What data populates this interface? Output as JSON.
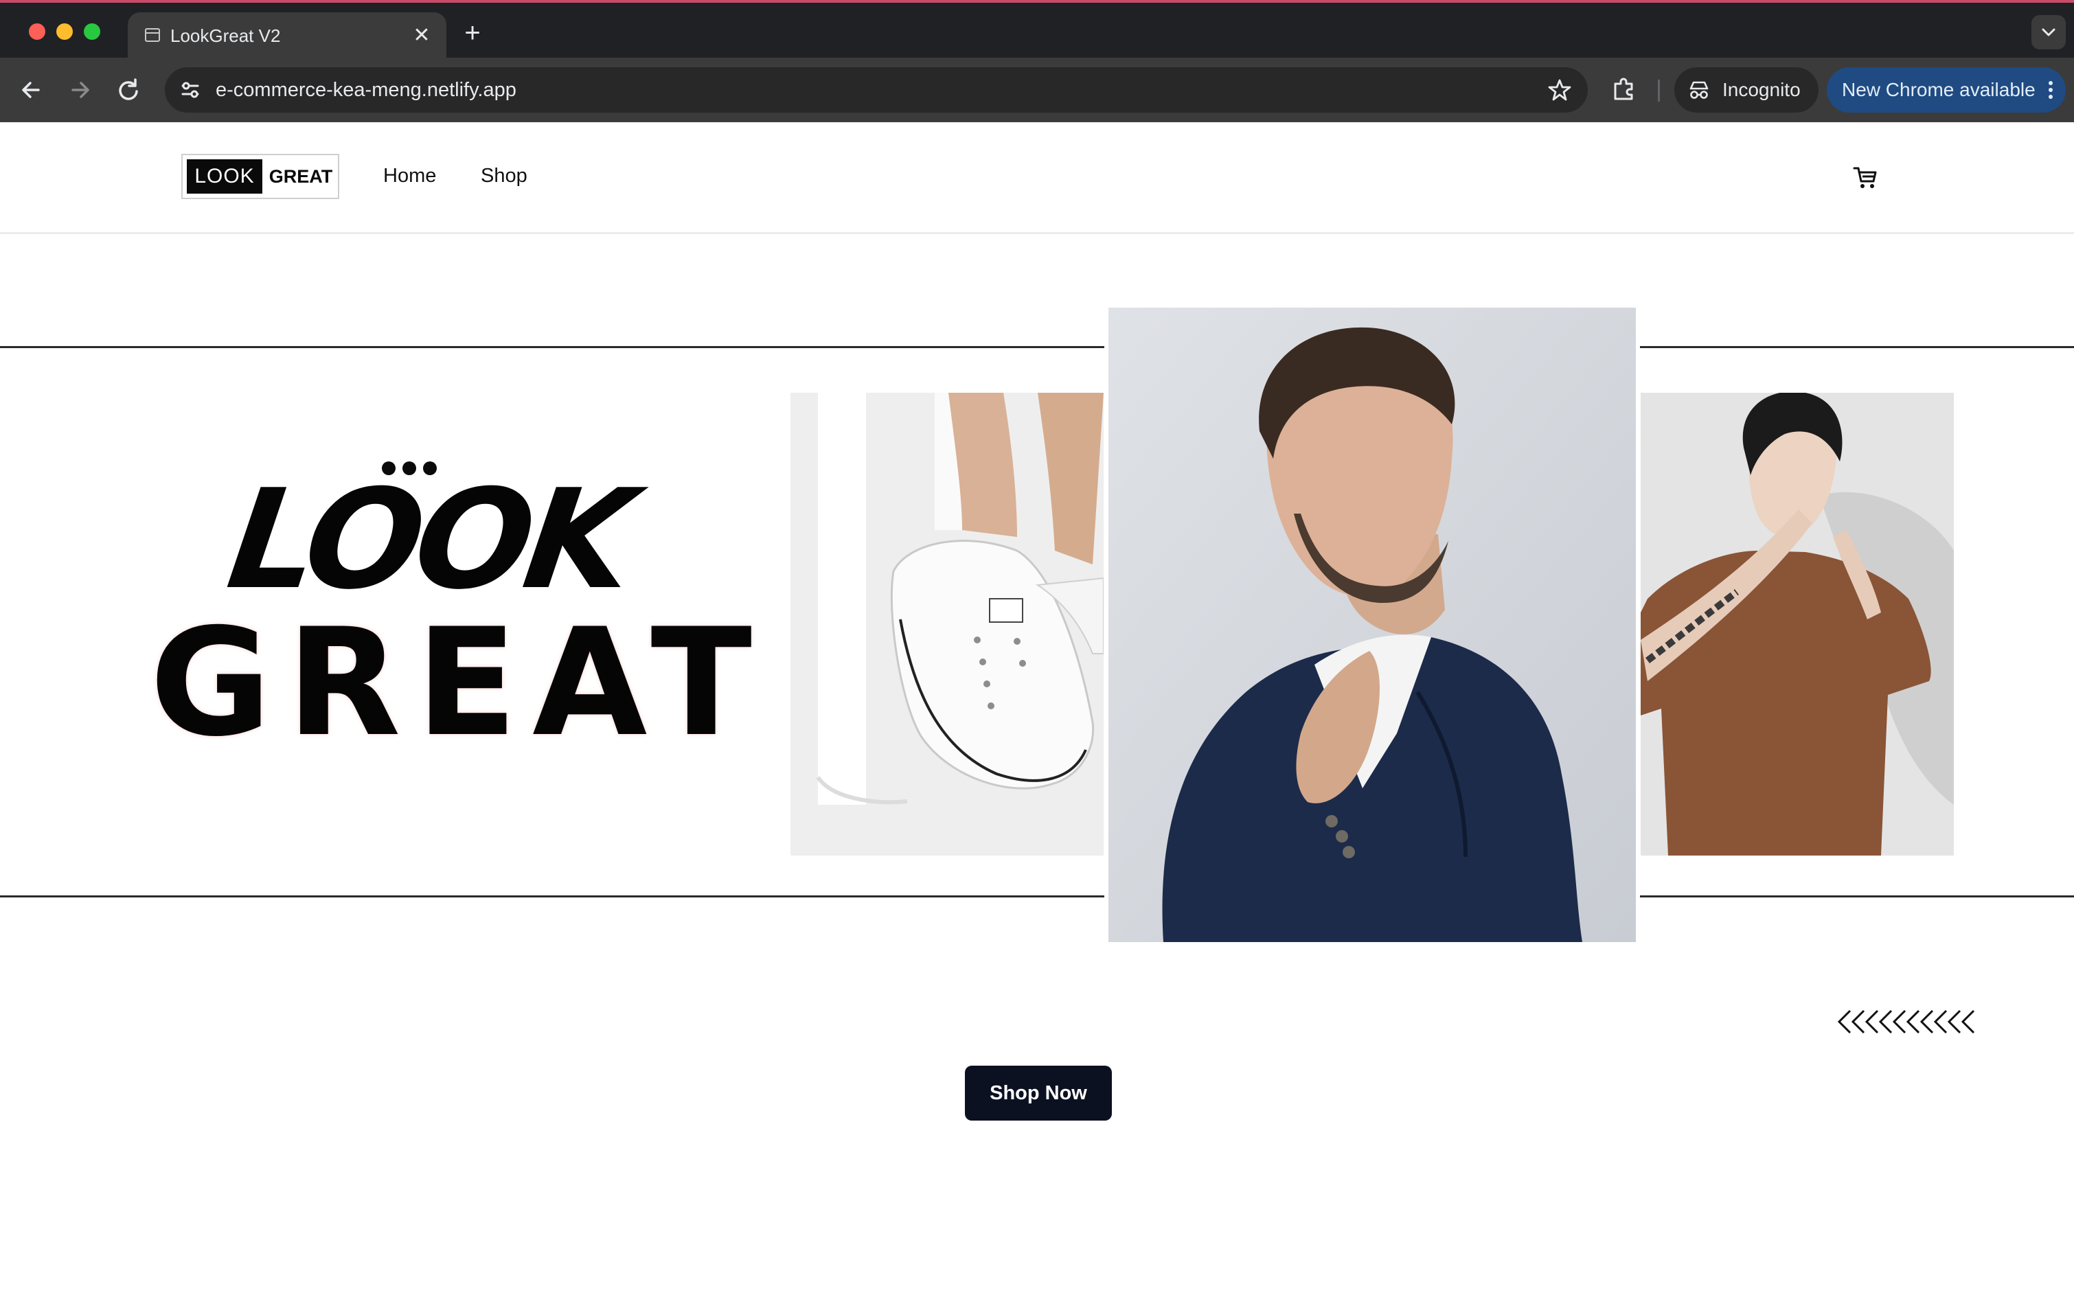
{
  "browser": {
    "tab_title": "LookGreat V2",
    "url": "e-commerce-kea-meng.netlify.app",
    "incognito_label": "Incognito",
    "update_label": "New Chrome available",
    "icons": {
      "back": "arrow-left-icon",
      "forward": "arrow-right-icon",
      "reload": "reload-icon",
      "site_info": "tune-icon",
      "bookmark": "star-icon",
      "extensions": "puzzle-icon",
      "incognito": "incognito-icon",
      "menu": "kebab-menu-icon",
      "tab_search": "chevron-down-icon"
    },
    "accent_color": "#1f4b82"
  },
  "site": {
    "logo": {
      "dark_part": "LOOK",
      "light_part": "GREAT"
    },
    "nav": [
      {
        "label": "Home"
      },
      {
        "label": "Shop"
      }
    ],
    "cart_icon": "shopping-cart-icon",
    "hero": {
      "wordmark_top": "LOOK",
      "wordmark_bottom": "GREAT",
      "decorative_chevrons": "<<<<<<<<<<",
      "images": [
        {
          "name": "white-sneakers-photo"
        },
        {
          "name": "man-in-navy-suit-photo"
        },
        {
          "name": "man-in-brown-tshirt-photo"
        }
      ]
    },
    "cta": {
      "label": "Shop Now",
      "color": "#0b1120"
    }
  }
}
